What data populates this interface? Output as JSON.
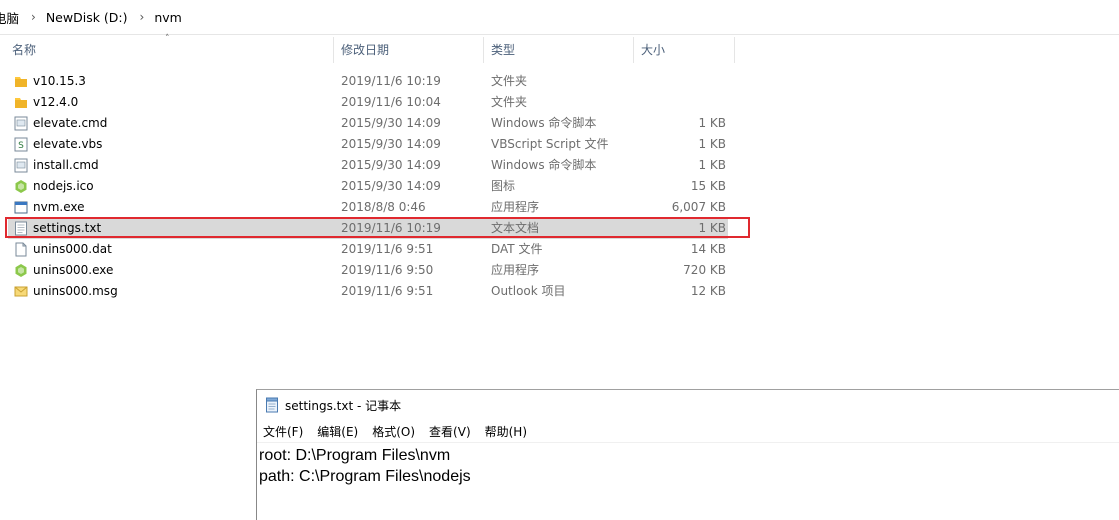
{
  "breadcrumb": {
    "items": [
      "电脑",
      "NewDisk (D:)",
      "nvm"
    ]
  },
  "columns": {
    "name": "名称",
    "date": "修改日期",
    "type": "类型",
    "size": "大小"
  },
  "files": [
    {
      "name": "v10.15.3",
      "date": "2019/11/6 10:19",
      "type": "文件夹",
      "size": "",
      "icon": "folder-icon"
    },
    {
      "name": "v12.4.0",
      "date": "2019/11/6 10:04",
      "type": "文件夹",
      "size": "",
      "icon": "folder-icon"
    },
    {
      "name": "elevate.cmd",
      "date": "2015/9/30 14:09",
      "type": "Windows 命令脚本",
      "size": "1 KB",
      "icon": "cmd-file-icon"
    },
    {
      "name": "elevate.vbs",
      "date": "2015/9/30 14:09",
      "type": "VBScript Script 文件",
      "size": "1 KB",
      "icon": "vbs-file-icon"
    },
    {
      "name": "install.cmd",
      "date": "2015/9/30 14:09",
      "type": "Windows 命令脚本",
      "size": "1 KB",
      "icon": "cmd-file-icon"
    },
    {
      "name": "nodejs.ico",
      "date": "2015/9/30 14:09",
      "type": "图标",
      "size": "15 KB",
      "icon": "nodejs-hexagon-icon"
    },
    {
      "name": "nvm.exe",
      "date": "2018/8/8 0:46",
      "type": "应用程序",
      "size": "6,007 KB",
      "icon": "exe-file-icon"
    },
    {
      "name": "settings.txt",
      "date": "2019/11/6 10:19",
      "type": "文本文档",
      "size": "1 KB",
      "icon": "text-file-icon"
    },
    {
      "name": "unins000.dat",
      "date": "2019/11/6 9:51",
      "type": "DAT 文件",
      "size": "14 KB",
      "icon": "blank-file-icon"
    },
    {
      "name": "unins000.exe",
      "date": "2019/11/6 9:50",
      "type": "应用程序",
      "size": "720 KB",
      "icon": "nodejs-hexagon-icon"
    },
    {
      "name": "unins000.msg",
      "date": "2019/11/6 9:51",
      "type": "Outlook 项目",
      "size": "12 KB",
      "icon": "mail-envelope-icon"
    }
  ],
  "selected_file": "settings.txt",
  "highlight_color": "#e0292f",
  "notepad": {
    "title": "settings.txt - 记事本",
    "menus": [
      "文件(F)",
      "编辑(E)",
      "格式(O)",
      "查看(V)",
      "帮助(H)"
    ],
    "lines": [
      "root: D:\\Program Files\\nvm",
      "path: C:\\Program Files\\nodejs"
    ]
  }
}
